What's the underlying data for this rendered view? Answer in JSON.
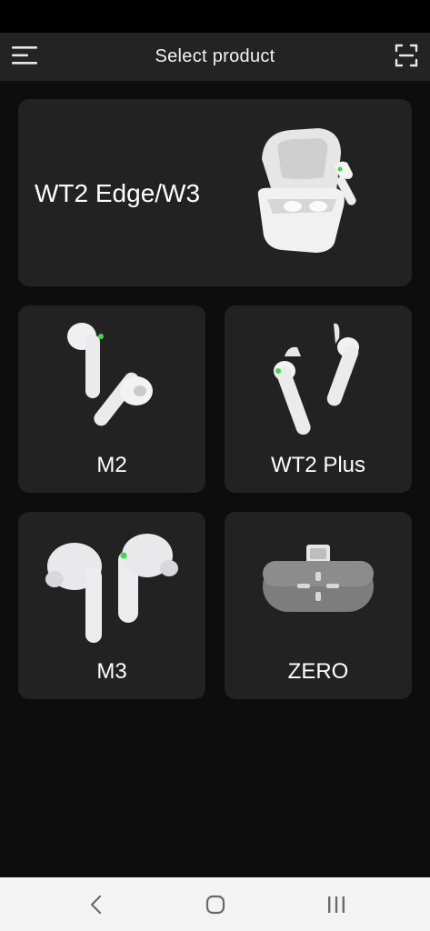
{
  "header": {
    "title": "Select product",
    "menu_icon": "hamburger-menu-icon",
    "scan_icon": "scan-icon"
  },
  "products": [
    {
      "label": "WT2 Edge/W3"
    },
    {
      "label": "M2"
    },
    {
      "label": "WT2 Plus"
    },
    {
      "label": "M3"
    },
    {
      "label": "ZERO"
    }
  ],
  "navbar": {
    "back_icon": "back-chevron-icon",
    "home_icon": "home-icon",
    "recent_icon": "recent-apps-icon"
  },
  "colors": {
    "background": "#0d0d0d",
    "appbar": "#232323",
    "card": "#222222",
    "led_green": "#3ddc4a",
    "navbar": "#f3f3f3"
  }
}
